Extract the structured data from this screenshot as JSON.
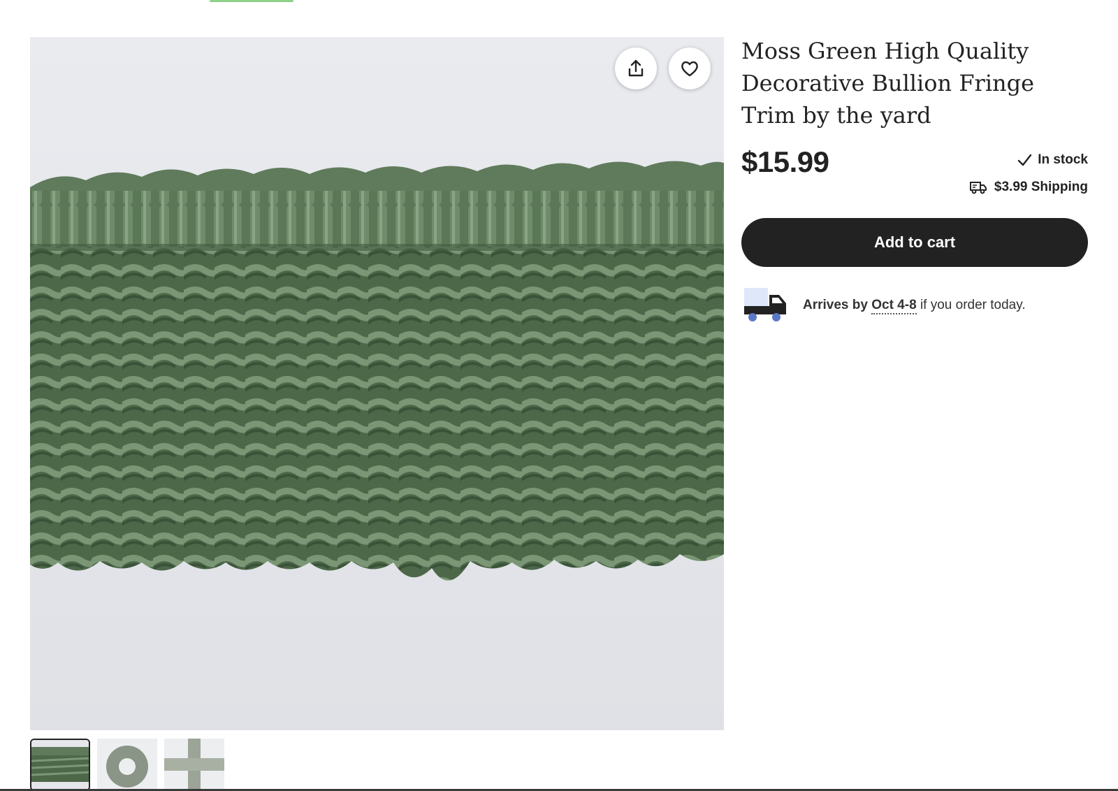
{
  "product": {
    "title": "Moss Green High Quality Decorative Bullion Fringe Trim by the yard",
    "price": "$15.99",
    "stock": "In stock",
    "shipping": "$3.99 Shipping",
    "add_to_cart": "Add to cart"
  },
  "delivery": {
    "prefix": "Arrives by",
    "dates": "Oct 4-8",
    "suffix": "if you order today."
  },
  "icons": {
    "share": "share-icon",
    "favorite": "heart-icon",
    "check": "check-icon",
    "shipping": "delivery-van-icon",
    "truck": "truck-icon"
  },
  "colors": {
    "fringe_green": "#4e6b4b",
    "button_dark": "#222222",
    "truck_blue": "#5a78c8"
  },
  "gallery": {
    "thumbnails": [
      "fringe-closeup",
      "fringe-coil",
      "fringe-cross"
    ],
    "selected_index": 0
  }
}
